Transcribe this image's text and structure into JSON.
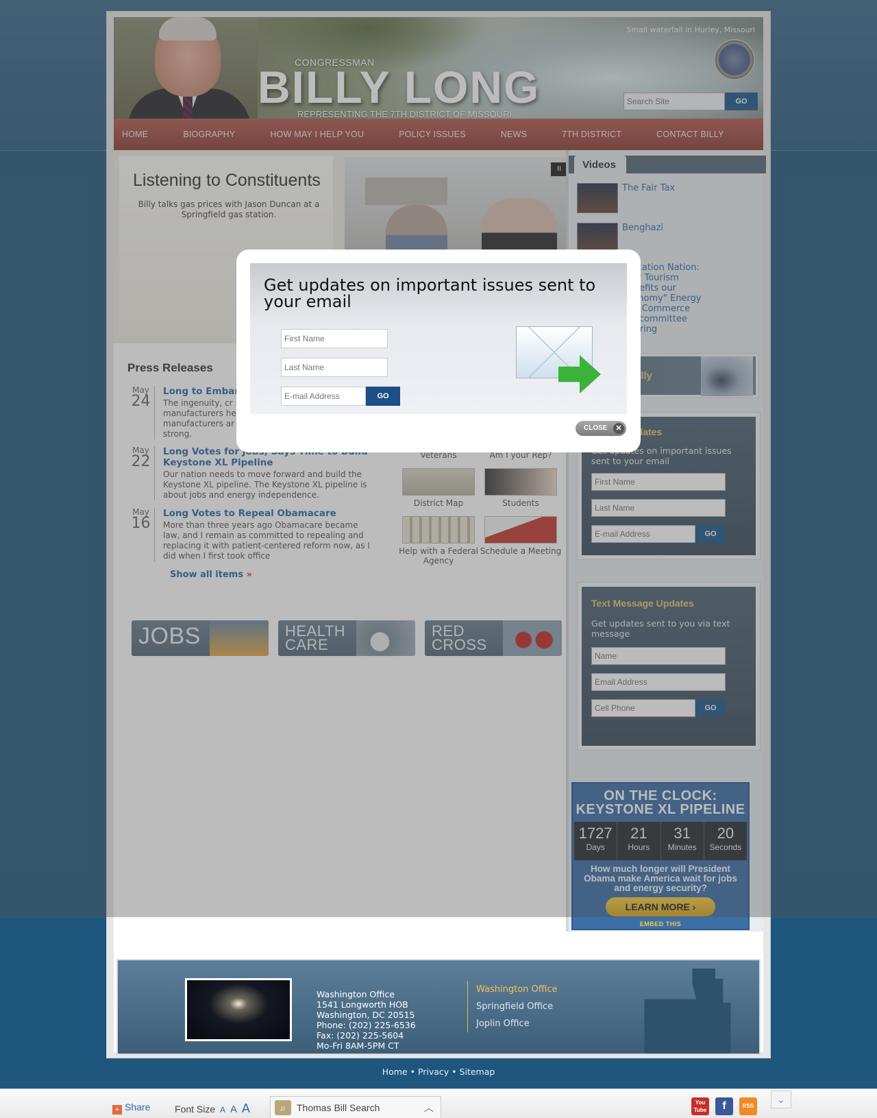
{
  "header": {
    "congressman": "CONGRESSMAN",
    "name": "BILLY LONG",
    "representing": "REPRESENTING THE 7TH DISTRICT OF MISSOURI",
    "photo_caption": "Small waterfall in Hurley, Missouri",
    "search_placeholder": "Search Site",
    "search_go": "GO"
  },
  "nav": [
    "HOME",
    "BIOGRAPHY",
    "HOW MAY I HELP YOU",
    "POLICY ISSUES",
    "NEWS",
    "7TH DISTRICT",
    "CONTACT BILLY"
  ],
  "feature": {
    "title": "Listening to Constituents",
    "description": "Billy talks gas prices with Jason Duncan at a Springfield gas station.",
    "pause_label": "II"
  },
  "videos": {
    "tab": "Videos",
    "items": [
      "The Fair Tax",
      "Benghazi",
      "\"Vacation Nation: How Tourism Benefits our Economy\" Energy and Commerce Subcommittee Hearing"
    ]
  },
  "contact_card": {
    "label": "t Billy"
  },
  "email_updates": {
    "title": "Updates",
    "description": "Get updates on important issues sent to your email",
    "first_name": "First Name",
    "last_name": "Last Name",
    "email": "E-mail Address",
    "go": "GO"
  },
  "text_updates": {
    "title": "Text Message Updates",
    "description": "Get updates sent to you via text message",
    "name": "Name",
    "email": "Email Address",
    "phone": "Cell Phone",
    "go": "GO"
  },
  "clock": {
    "title_line1": "ON THE CLOCK:",
    "title_line2": "KEYSTONE XL PIPELINE",
    "days": "1727",
    "days_label": "Days",
    "hours": "21",
    "hours_label": "Hours",
    "minutes": "31",
    "minutes_label": "Minutes",
    "seconds": "20",
    "seconds_label": "Seconds",
    "question": "How much longer will President Obama make America wait for jobs and energy security?",
    "learn_more": "LEARN MORE ›",
    "embed": "EMBED THIS"
  },
  "press": {
    "title": "Press Releases",
    "items": [
      {
        "month": "May",
        "day": "24",
        "headline": "Long to Embar",
        "body": "The ingenuity, cr manufacturers he manufacturers ar strong."
      },
      {
        "month": "May",
        "day": "22",
        "headline": "Long Votes for Jobs; Says Time to Build Keystone XL Pipeline",
        "body": "Our nation needs to move forward and build the Keystone XL pipeline. The Keystone XL pipeline is about jobs and energy independence."
      },
      {
        "month": "May",
        "day": "16",
        "headline": "Long Votes to Repeal Obamacare",
        "body": "More than three years ago Obamacare became law, and I remain as committed to repealing and replacing it with patient-centered reform now, as I did when I first took office"
      }
    ],
    "show_all": "Show all items",
    "show_all_arrow": "»"
  },
  "tiles": [
    "Veterans",
    "Am I your Rep?",
    "District Map",
    "Students",
    "Help with a Federal Agency",
    "Schedule a Meeting"
  ],
  "banners": [
    "JOBS",
    "HEALTH",
    "CARE",
    "RED",
    "CROSS"
  ],
  "footer": {
    "office_title": "Washington Office",
    "address1": "1541 Longworth HOB",
    "address2": "Washington, DC 20515",
    "phone": "Phone: (202) 225-6536",
    "fax": "Fax: (202) 225-5604",
    "hours": "Mo-Fri 8AM-5PM CT",
    "links": [
      "Washington Office",
      "Springfield Office",
      "Joplin Office"
    ]
  },
  "sitelinks": [
    "Home",
    "Privacy",
    "Sitemap"
  ],
  "toolbar": {
    "share": "Share",
    "font_size": "Font Size",
    "font_a": [
      "A",
      "A",
      "A"
    ],
    "thomas": "Thomas Bill Search",
    "social": [
      "You Tube",
      "f",
      "RSS"
    ]
  },
  "modal": {
    "title": "Get updates on important issues sent to your email",
    "first_name": "First Name",
    "last_name": "Last Name",
    "email": "E-mail Address",
    "go": "GO",
    "close": "CLOSE"
  },
  "colors": {
    "nav": "#9c4a40",
    "accent_gold": "#e6c872",
    "link": "#2b6aa8",
    "button": "#205a8c"
  }
}
